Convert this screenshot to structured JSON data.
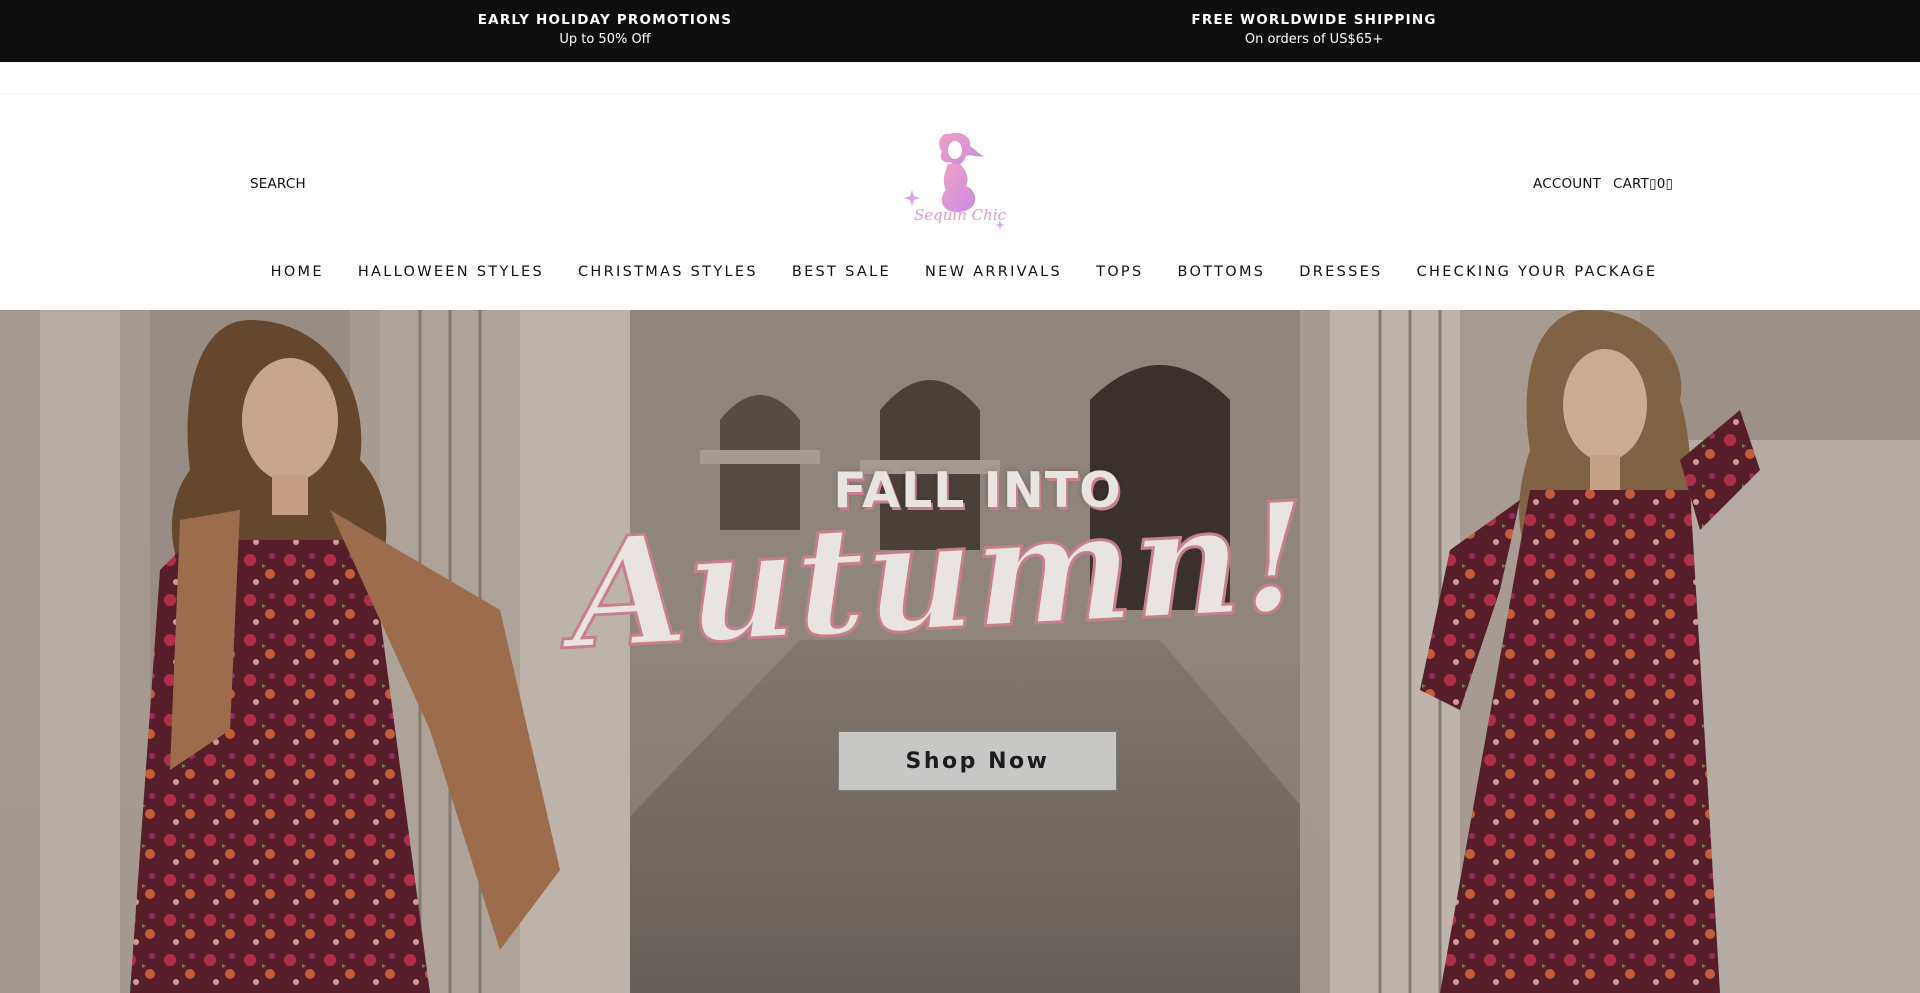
{
  "announcement": {
    "left": {
      "title": "EARLY HOLIDAY PROMOTIONS",
      "subtitle": "Up to 50% Off"
    },
    "right": {
      "title": "FREE WORLDWIDE SHIPPING",
      "subtitle": "On orders of US$65+"
    }
  },
  "header": {
    "search_label": "SEARCH",
    "account_label": "ACCOUNT",
    "cart_label": "CART▯0▯",
    "logo_text": "Sequin Chic",
    "logo_color": "#d98ad6"
  },
  "nav": {
    "items": [
      {
        "label": "HOME"
      },
      {
        "label": "HALLOWEEN STYLES"
      },
      {
        "label": "CHRISTMAS STYLES"
      },
      {
        "label": "BEST SALE"
      },
      {
        "label": "NEW ARRIVALS"
      },
      {
        "label": "TOPS"
      },
      {
        "label": "BOTTOMS"
      },
      {
        "label": "DRESSES"
      },
      {
        "label": "CHECKING YOUR PACKAGE"
      }
    ]
  },
  "hero": {
    "headline_top": "FALL INTO",
    "headline_script": "Autumn!",
    "cta_label": "Shop Now",
    "accent_color": "#c77f8c",
    "dress_color": "#8a1f3a"
  }
}
